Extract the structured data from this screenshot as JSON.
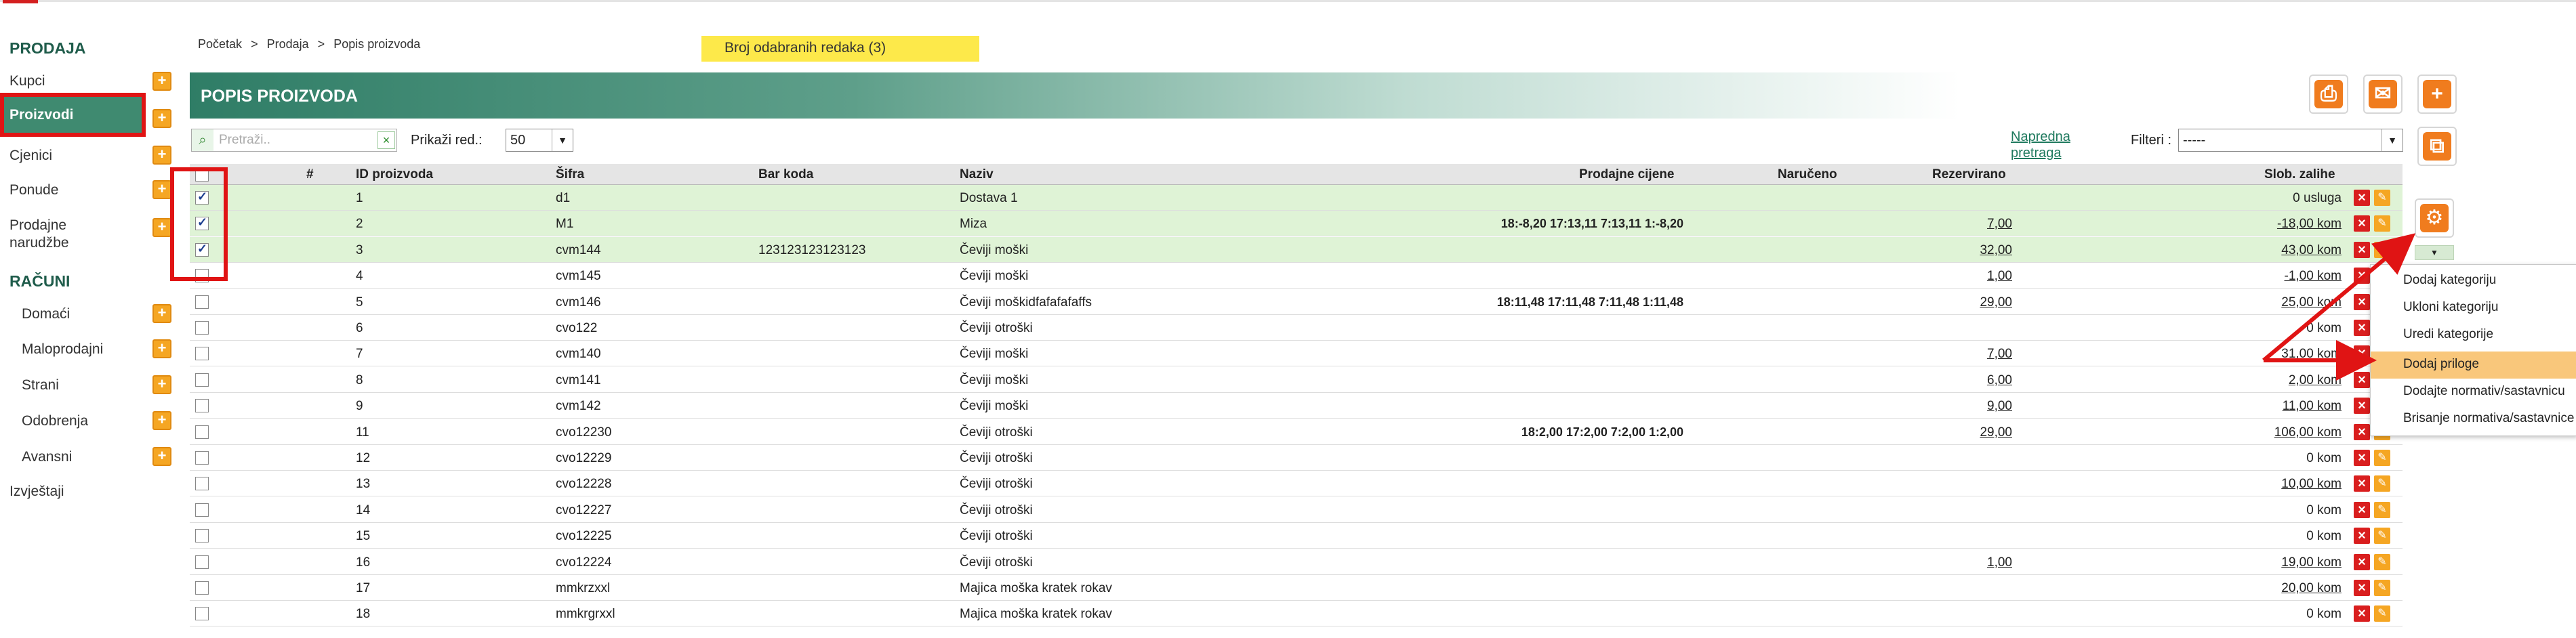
{
  "sidebar": {
    "section_sales": "PRODAJA",
    "items_sales": [
      "Kupci",
      "Proizvodi",
      "Cjenici",
      "Ponude",
      "Prodajne narudžbe"
    ],
    "section_accounts": "RAČUNI",
    "items_accounts": [
      "Domaći",
      "Maloprodajni",
      "Strani",
      "Odobrenja",
      "Avansni"
    ],
    "reports": "Izvještaji",
    "plus": "+"
  },
  "breadcrumb": {
    "home": "Početak",
    "sep": ">",
    "sales": "Prodaja",
    "current": "Popis proizvoda"
  },
  "selected_banner": "Broj odabranih redaka (3)",
  "header": {
    "title": "POPIS PROIZVODA"
  },
  "toolbar": {
    "search_placeholder": "Pretraži..",
    "show_rows_label": "Prikaži red.:",
    "show_rows_value": "50",
    "advanced_search_line1": "Napredna",
    "advanced_search_line2": "pretraga",
    "filters_label": "Filteri :",
    "filters_value": "-----"
  },
  "table": {
    "headers": [
      "#",
      "ID proizvoda",
      "Šifra",
      "Bar koda",
      "Naziv",
      "Prodajne cijene",
      "Naručeno",
      "Rezervirano",
      "Slob. zalihe"
    ],
    "rows": [
      {
        "checked": true,
        "id": "1",
        "sifra": "d1",
        "barcode": "",
        "naziv": "Dostava 1",
        "prices": "",
        "rezervirano": "",
        "zalihe": "0 usluga",
        "zalihe_link": false
      },
      {
        "checked": true,
        "id": "2",
        "sifra": "M1",
        "barcode": "",
        "naziv": "Miza",
        "prices": "18:-8,20 17:13,11 7:13,11 1:-8,20",
        "rezervirano": "7,00",
        "zalihe": "-18,00 kom",
        "zalihe_link": true
      },
      {
        "checked": true,
        "id": "3",
        "sifra": "cvm144",
        "barcode": "123123123123123",
        "naziv": "Čeviji moški",
        "prices": "",
        "rezervirano": "32,00",
        "zalihe": "43,00 kom",
        "zalihe_link": true
      },
      {
        "checked": false,
        "id": "4",
        "sifra": "cvm145",
        "barcode": "",
        "naziv": "Čeviji moški",
        "prices": "",
        "rezervirano": "1,00",
        "zalihe": "-1,00 kom",
        "zalihe_link": true
      },
      {
        "checked": false,
        "id": "5",
        "sifra": "cvm146",
        "barcode": "",
        "naziv": "Čeviji moškidfafafafaffs",
        "prices": "18:11,48 17:11,48 7:11,48 1:11,48",
        "rezervirano": "29,00",
        "zalihe": "25,00 kom",
        "zalihe_link": true
      },
      {
        "checked": false,
        "id": "6",
        "sifra": "cvo122",
        "barcode": "",
        "naziv": "Čeviji otroški",
        "prices": "",
        "rezervirano": "",
        "zalihe": "0 kom",
        "zalihe_link": false
      },
      {
        "checked": false,
        "id": "7",
        "sifra": "cvm140",
        "barcode": "",
        "naziv": "Čeviji moški",
        "prices": "",
        "rezervirano": "7,00",
        "zalihe": "31,00 kom",
        "zalihe_link": true
      },
      {
        "checked": false,
        "id": "8",
        "sifra": "cvm141",
        "barcode": "",
        "naziv": "Čeviji moški",
        "prices": "",
        "rezervirano": "6,00",
        "zalihe": "2,00 kom",
        "zalihe_link": true
      },
      {
        "checked": false,
        "id": "9",
        "sifra": "cvm142",
        "barcode": "",
        "naziv": "Čeviji moški",
        "prices": "",
        "rezervirano": "9,00",
        "zalihe": "11,00 kom",
        "zalihe_link": true
      },
      {
        "checked": false,
        "id": "11",
        "sifra": "cvo12230",
        "barcode": "",
        "naziv": "Čeviji otroški",
        "prices": "18:2,00 17:2,00 7:2,00 1:2,00",
        "rezervirano": "29,00",
        "zalihe": "106,00 kom",
        "zalihe_link": true
      },
      {
        "checked": false,
        "id": "12",
        "sifra": "cvo12229",
        "barcode": "",
        "naziv": "Čeviji otroški",
        "prices": "",
        "rezervirano": "",
        "zalihe": "0 kom",
        "zalihe_link": false
      },
      {
        "checked": false,
        "id": "13",
        "sifra": "cvo12228",
        "barcode": "",
        "naziv": "Čeviji otroški",
        "prices": "",
        "rezervirano": "",
        "zalihe": "10,00 kom",
        "zalihe_link": true
      },
      {
        "checked": false,
        "id": "14",
        "sifra": "cvo12227",
        "barcode": "",
        "naziv": "Čeviji otroški",
        "prices": "",
        "rezervirano": "",
        "zalihe": "0 kom",
        "zalihe_link": false
      },
      {
        "checked": false,
        "id": "15",
        "sifra": "cvo12225",
        "barcode": "",
        "naziv": "Čeviji otroški",
        "prices": "",
        "rezervirano": "",
        "zalihe": "0 kom",
        "zalihe_link": false
      },
      {
        "checked": false,
        "id": "16",
        "sifra": "cvo12224",
        "barcode": "",
        "naziv": "Čeviji otroški",
        "prices": "",
        "rezervirano": "1,00",
        "zalihe": "19,00 kom",
        "zalihe_link": true
      },
      {
        "checked": false,
        "id": "17",
        "sifra": "mmkrzxxl",
        "barcode": "",
        "naziv": "Majica moška kratek rokav",
        "prices": "",
        "rezervirano": "",
        "zalihe": "20,00 kom",
        "zalihe_link": true
      },
      {
        "checked": false,
        "id": "18",
        "sifra": "mmkrgrxxl",
        "barcode": "",
        "naziv": "Majica moška kratek rokav",
        "prices": "",
        "rezervirano": "",
        "zalihe": "0 kom",
        "zalihe_link": false
      }
    ]
  },
  "action_menu": {
    "items": [
      "Dodaj kategoriju",
      "Ukloni kategoriju",
      "Uredi kategorije",
      "Dodaj priloge",
      "Dodajte normativ/sastavnicu",
      "Brisanje normativa/sastavnice"
    ],
    "highlighted": "Dodaj priloge"
  },
  "icons": {
    "print": "printer-icon",
    "email": "envelope-icon",
    "add": "plus-icon",
    "copy": "copy-icon",
    "settings": "gear-icon",
    "delete": "delete-icon",
    "edit": "pencil-icon"
  },
  "colors": {
    "accent": "#3f8a70",
    "orange": "#f07c1e",
    "highlight": "#fde94a",
    "selected_row": "#dff3d6",
    "annotation": "#e01414"
  }
}
